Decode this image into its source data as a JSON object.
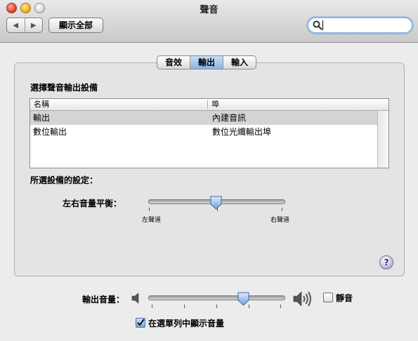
{
  "window": {
    "title": "聲音"
  },
  "toolbar": {
    "back_glyph": "◀",
    "forward_glyph": "▶",
    "show_all_label": "顯示全部",
    "search_value": ""
  },
  "tabs": [
    {
      "label": "音效",
      "active": false
    },
    {
      "label": "輸出",
      "active": true
    },
    {
      "label": "輸入",
      "active": false
    }
  ],
  "output": {
    "section_title": "選擇聲音輸出設備",
    "columns": [
      "名稱",
      "埠"
    ],
    "rows": [
      {
        "name": "輸出",
        "port": "內建音訊",
        "selected": true
      },
      {
        "name": "數位輸出",
        "port": "數位光纖輸出埠",
        "selected": false
      }
    ]
  },
  "device_settings": {
    "title": "所選設備的設定：",
    "balance_label": "左右音量平衡：",
    "balance_left": "左聲道",
    "balance_right": "右聲道",
    "balance_value": 0.5
  },
  "help_glyph": "?",
  "output_volume": {
    "label": "輸出音量：",
    "value": 0.7,
    "mute_label": "靜音",
    "mute_checked": false,
    "show_in_menubar_label": "在選單列中顯示音量",
    "show_in_menubar_checked": true
  },
  "colors": {
    "accent": "#8ab4ea",
    "selected_row": "#d4d4d4",
    "panel_bg": "#e4e4e4"
  }
}
